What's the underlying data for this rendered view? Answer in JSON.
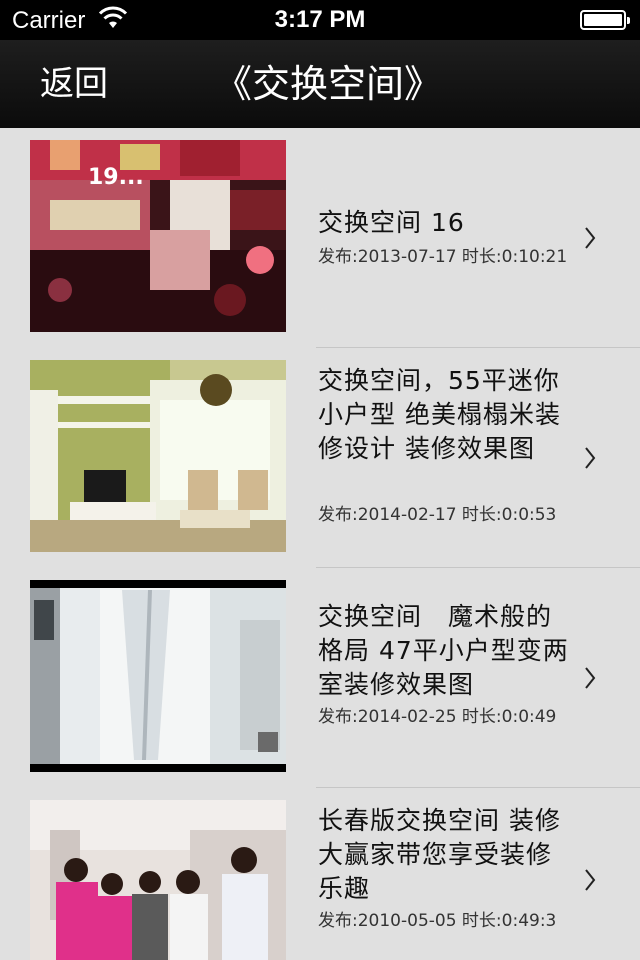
{
  "status_bar": {
    "carrier": "Carrier",
    "time": "3:17 PM"
  },
  "nav": {
    "back_label": "返回",
    "title": "《交换空间》"
  },
  "videos": [
    {
      "title": "交换空间 16",
      "meta": "发布:2013-07-17 时长:0:10:21"
    },
    {
      "title": "交换空间，55平迷你小户型 绝美榻榻米装修设计 装修效果图",
      "meta": "发布:2014-02-17 时长:0:0:53"
    },
    {
      "title": "交换空间　魔术般的格局 47平小户型变两室装修效果图",
      "meta": "发布:2014-02-25 时长:0:0:49"
    },
    {
      "title": "长春版交换空间  装修大赢家带您享受装修乐趣",
      "meta": "发布:2010-05-05 时长:0:49:3"
    }
  ],
  "thumbnail_captions": [
    "19..."
  ],
  "colors": {
    "nav_bg": "#111111",
    "list_bg": "#e0e0e0",
    "separator": "#c6c6c6"
  }
}
